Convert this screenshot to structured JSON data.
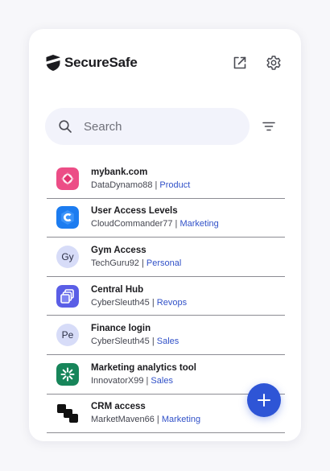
{
  "app": {
    "title": "SecureSafe",
    "colors": {
      "accent": "#2e55d6",
      "tag": "#3151c8",
      "search_bg": "#f2f3fb"
    }
  },
  "header": {
    "icons": [
      "shield-logo-icon",
      "open-in-new-icon",
      "settings-icon"
    ]
  },
  "search": {
    "placeholder": "Search",
    "value": ""
  },
  "items": [
    {
      "title": "mybank.com",
      "user": "DataDynamo88",
      "tag": "Product",
      "icon": "mybank-logo-icon",
      "icon_color": "#e8457e"
    },
    {
      "title": "User Access Levels",
      "user": "CloudCommander77",
      "tag": "Marketing",
      "icon": "cloud-c-logo-icon",
      "icon_color": "#1f7de8"
    },
    {
      "title": "Gym Access",
      "user": "TechGuru92",
      "tag": "Personal",
      "icon": "initials-avatar",
      "initials": "Gy"
    },
    {
      "title": "Central Hub",
      "user": "CyberSleuth45",
      "tag": "Revops",
      "icon": "stacked-squares-logo-icon",
      "icon_color": "#5b5fe0"
    },
    {
      "title": "Finance login",
      "user": "CyberSleuth45",
      "tag": "Sales",
      "icon": "initials-avatar",
      "initials": "Pe"
    },
    {
      "title": "Marketing analytics tool",
      "user": "InnovatorX99",
      "tag": "Sales",
      "icon": "asterisk-logo-icon",
      "icon_color": "#1a8a5e"
    },
    {
      "title": "CRM access",
      "user": "MarketMaven66",
      "tag": "Marketing",
      "icon": "black-blocks-logo-icon",
      "icon_color": "#111111"
    }
  ],
  "separator": " | ",
  "fab": {
    "icon": "plus-icon"
  }
}
